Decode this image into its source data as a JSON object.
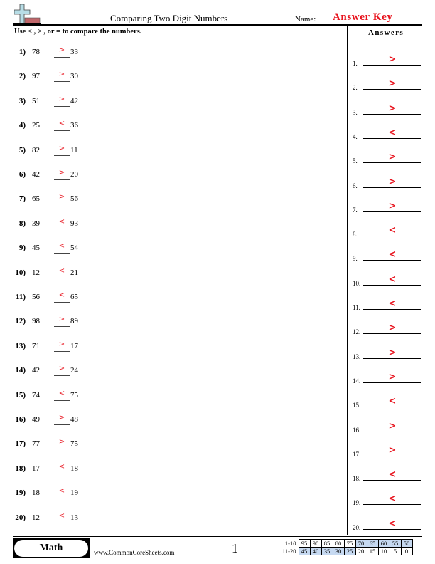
{
  "header": {
    "title": "Comparing Two Digit Numbers",
    "name_label": "Name:",
    "name_value": "Answer Key",
    "logo_icon": "plus-ruler-logo-icon",
    "accent_color": "#e8141e"
  },
  "instructions": "Use < , > , or = to compare the numbers.",
  "problems": [
    {
      "num": "1)",
      "a": "78",
      "answer": ">",
      "b": "33"
    },
    {
      "num": "2)",
      "a": "97",
      "answer": ">",
      "b": "30"
    },
    {
      "num": "3)",
      "a": "51",
      "answer": ">",
      "b": "42"
    },
    {
      "num": "4)",
      "a": "25",
      "answer": "<",
      "b": "36"
    },
    {
      "num": "5)",
      "a": "82",
      "answer": ">",
      "b": "11"
    },
    {
      "num": "6)",
      "a": "42",
      "answer": ">",
      "b": "20"
    },
    {
      "num": "7)",
      "a": "65",
      "answer": ">",
      "b": "56"
    },
    {
      "num": "8)",
      "a": "39",
      "answer": "<",
      "b": "93"
    },
    {
      "num": "9)",
      "a": "45",
      "answer": "<",
      "b": "54"
    },
    {
      "num": "10)",
      "a": "12",
      "answer": "<",
      "b": "21"
    },
    {
      "num": "11)",
      "a": "56",
      "answer": "<",
      "b": "65"
    },
    {
      "num": "12)",
      "a": "98",
      "answer": ">",
      "b": "89"
    },
    {
      "num": "13)",
      "a": "71",
      "answer": ">",
      "b": "17"
    },
    {
      "num": "14)",
      "a": "42",
      "answer": ">",
      "b": "24"
    },
    {
      "num": "15)",
      "a": "74",
      "answer": "<",
      "b": "75"
    },
    {
      "num": "16)",
      "a": "49",
      "answer": ">",
      "b": "48"
    },
    {
      "num": "17)",
      "a": "77",
      "answer": ">",
      "b": "75"
    },
    {
      "num": "18)",
      "a": "17",
      "answer": "<",
      "b": "18"
    },
    {
      "num": "19)",
      "a": "18",
      "answer": "<",
      "b": "19"
    },
    {
      "num": "20)",
      "a": "12",
      "answer": "<",
      "b": "13"
    }
  ],
  "answers_panel": {
    "title": "Answers",
    "items": [
      {
        "num": "1.",
        "value": ">"
      },
      {
        "num": "2.",
        "value": ">"
      },
      {
        "num": "3.",
        "value": ">"
      },
      {
        "num": "4.",
        "value": "<"
      },
      {
        "num": "5.",
        "value": ">"
      },
      {
        "num": "6.",
        "value": ">"
      },
      {
        "num": "7.",
        "value": ">"
      },
      {
        "num": "8.",
        "value": "<"
      },
      {
        "num": "9.",
        "value": "<"
      },
      {
        "num": "10.",
        "value": "<"
      },
      {
        "num": "11.",
        "value": "<"
      },
      {
        "num": "12.",
        "value": ">"
      },
      {
        "num": "13.",
        "value": ">"
      },
      {
        "num": "14.",
        "value": ">"
      },
      {
        "num": "15.",
        "value": "<"
      },
      {
        "num": "16.",
        "value": ">"
      },
      {
        "num": "17.",
        "value": ">"
      },
      {
        "num": "18.",
        "value": "<"
      },
      {
        "num": "19.",
        "value": "<"
      },
      {
        "num": "20.",
        "value": "<"
      }
    ]
  },
  "footer": {
    "subject": "Math",
    "site": "www.CommonCoreSheets.com",
    "page": "1",
    "score_table": {
      "rows": [
        {
          "label": "1-10",
          "values": [
            "95",
            "90",
            "85",
            "80",
            "75",
            "70",
            "65",
            "60",
            "55",
            "50"
          ],
          "highlighted": [
            false,
            false,
            false,
            false,
            false,
            true,
            true,
            true,
            true,
            true
          ]
        },
        {
          "label": "11-20",
          "values": [
            "45",
            "40",
            "35",
            "30",
            "25",
            "20",
            "15",
            "10",
            "5",
            "0"
          ],
          "highlighted": [
            true,
            true,
            true,
            true,
            true,
            false,
            false,
            false,
            false,
            false
          ]
        }
      ]
    }
  }
}
